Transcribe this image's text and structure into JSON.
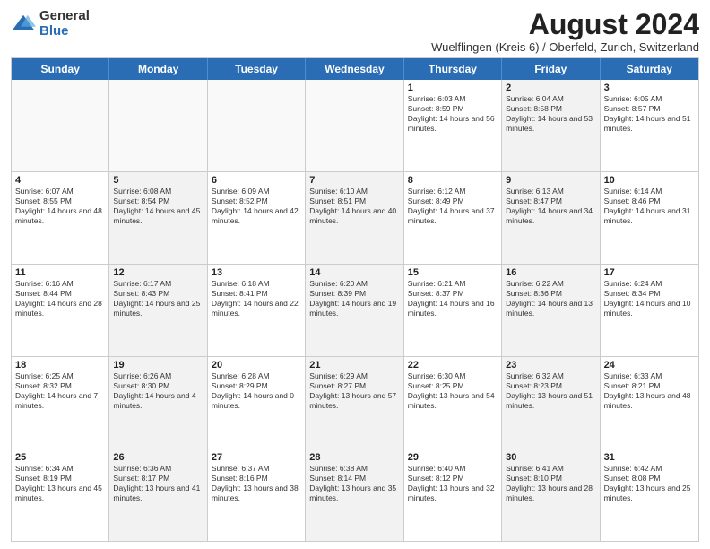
{
  "logo": {
    "general": "General",
    "blue": "Blue"
  },
  "title": "August 2024",
  "subtitle": "Wuelflingen (Kreis 6) / Oberfeld, Zurich, Switzerland",
  "header_days": [
    "Sunday",
    "Monday",
    "Tuesday",
    "Wednesday",
    "Thursday",
    "Friday",
    "Saturday"
  ],
  "rows": [
    [
      {
        "day": "",
        "info": "",
        "empty": true
      },
      {
        "day": "",
        "info": "",
        "empty": true
      },
      {
        "day": "",
        "info": "",
        "empty": true
      },
      {
        "day": "",
        "info": "",
        "empty": true
      },
      {
        "day": "1",
        "info": "Sunrise: 6:03 AM\nSunset: 8:59 PM\nDaylight: 14 hours and 56 minutes."
      },
      {
        "day": "2",
        "info": "Sunrise: 6:04 AM\nSunset: 8:58 PM\nDaylight: 14 hours and 53 minutes.",
        "alt": true
      },
      {
        "day": "3",
        "info": "Sunrise: 6:05 AM\nSunset: 8:57 PM\nDaylight: 14 hours and 51 minutes."
      }
    ],
    [
      {
        "day": "4",
        "info": "Sunrise: 6:07 AM\nSunset: 8:55 PM\nDaylight: 14 hours and 48 minutes."
      },
      {
        "day": "5",
        "info": "Sunrise: 6:08 AM\nSunset: 8:54 PM\nDaylight: 14 hours and 45 minutes.",
        "alt": true
      },
      {
        "day": "6",
        "info": "Sunrise: 6:09 AM\nSunset: 8:52 PM\nDaylight: 14 hours and 42 minutes."
      },
      {
        "day": "7",
        "info": "Sunrise: 6:10 AM\nSunset: 8:51 PM\nDaylight: 14 hours and 40 minutes.",
        "alt": true
      },
      {
        "day": "8",
        "info": "Sunrise: 6:12 AM\nSunset: 8:49 PM\nDaylight: 14 hours and 37 minutes."
      },
      {
        "day": "9",
        "info": "Sunrise: 6:13 AM\nSunset: 8:47 PM\nDaylight: 14 hours and 34 minutes.",
        "alt": true
      },
      {
        "day": "10",
        "info": "Sunrise: 6:14 AM\nSunset: 8:46 PM\nDaylight: 14 hours and 31 minutes."
      }
    ],
    [
      {
        "day": "11",
        "info": "Sunrise: 6:16 AM\nSunset: 8:44 PM\nDaylight: 14 hours and 28 minutes."
      },
      {
        "day": "12",
        "info": "Sunrise: 6:17 AM\nSunset: 8:43 PM\nDaylight: 14 hours and 25 minutes.",
        "alt": true
      },
      {
        "day": "13",
        "info": "Sunrise: 6:18 AM\nSunset: 8:41 PM\nDaylight: 14 hours and 22 minutes."
      },
      {
        "day": "14",
        "info": "Sunrise: 6:20 AM\nSunset: 8:39 PM\nDaylight: 14 hours and 19 minutes.",
        "alt": true
      },
      {
        "day": "15",
        "info": "Sunrise: 6:21 AM\nSunset: 8:37 PM\nDaylight: 14 hours and 16 minutes."
      },
      {
        "day": "16",
        "info": "Sunrise: 6:22 AM\nSunset: 8:36 PM\nDaylight: 14 hours and 13 minutes.",
        "alt": true
      },
      {
        "day": "17",
        "info": "Sunrise: 6:24 AM\nSunset: 8:34 PM\nDaylight: 14 hours and 10 minutes."
      }
    ],
    [
      {
        "day": "18",
        "info": "Sunrise: 6:25 AM\nSunset: 8:32 PM\nDaylight: 14 hours and 7 minutes."
      },
      {
        "day": "19",
        "info": "Sunrise: 6:26 AM\nSunset: 8:30 PM\nDaylight: 14 hours and 4 minutes.",
        "alt": true
      },
      {
        "day": "20",
        "info": "Sunrise: 6:28 AM\nSunset: 8:29 PM\nDaylight: 14 hours and 0 minutes."
      },
      {
        "day": "21",
        "info": "Sunrise: 6:29 AM\nSunset: 8:27 PM\nDaylight: 13 hours and 57 minutes.",
        "alt": true
      },
      {
        "day": "22",
        "info": "Sunrise: 6:30 AM\nSunset: 8:25 PM\nDaylight: 13 hours and 54 minutes."
      },
      {
        "day": "23",
        "info": "Sunrise: 6:32 AM\nSunset: 8:23 PM\nDaylight: 13 hours and 51 minutes.",
        "alt": true
      },
      {
        "day": "24",
        "info": "Sunrise: 6:33 AM\nSunset: 8:21 PM\nDaylight: 13 hours and 48 minutes."
      }
    ],
    [
      {
        "day": "25",
        "info": "Sunrise: 6:34 AM\nSunset: 8:19 PM\nDaylight: 13 hours and 45 minutes."
      },
      {
        "day": "26",
        "info": "Sunrise: 6:36 AM\nSunset: 8:17 PM\nDaylight: 13 hours and 41 minutes.",
        "alt": true
      },
      {
        "day": "27",
        "info": "Sunrise: 6:37 AM\nSunset: 8:16 PM\nDaylight: 13 hours and 38 minutes."
      },
      {
        "day": "28",
        "info": "Sunrise: 6:38 AM\nSunset: 8:14 PM\nDaylight: 13 hours and 35 minutes.",
        "alt": true
      },
      {
        "day": "29",
        "info": "Sunrise: 6:40 AM\nSunset: 8:12 PM\nDaylight: 13 hours and 32 minutes."
      },
      {
        "day": "30",
        "info": "Sunrise: 6:41 AM\nSunset: 8:10 PM\nDaylight: 13 hours and 28 minutes.",
        "alt": true
      },
      {
        "day": "31",
        "info": "Sunrise: 6:42 AM\nSunset: 8:08 PM\nDaylight: 13 hours and 25 minutes."
      }
    ]
  ]
}
